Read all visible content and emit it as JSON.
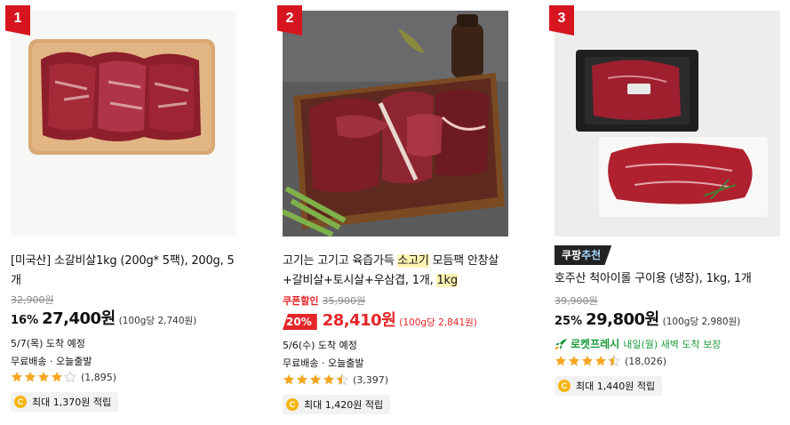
{
  "products": [
    {
      "rank": "1",
      "title_parts": [
        {
          "text": "[미국산] 소갈비살1kg (200g* 5팩), 200g, 5개",
          "hl": false
        }
      ],
      "original_price": "32,900원",
      "discount": "16%",
      "price": "27,400원",
      "unit_price": "(100g당 2,740원)",
      "delivery": "5/7(목) 도착 예정",
      "shipping": "무료배송 · 오늘출발",
      "rating": 4,
      "review_count": "(1,895)",
      "reward": "최대 1,370원 적립",
      "coin_icon": "coin-icon",
      "image_icon": "meat-photo"
    },
    {
      "rank": "2",
      "title_parts": [
        {
          "text": "고기는 고기고 육즙가득 ",
          "hl": false
        },
        {
          "text": "소고기",
          "hl": true
        },
        {
          "text": " 모듬팩 안창살+갈비살+토시살+우삼겹, 1개, ",
          "hl": false
        },
        {
          "text": "1kg",
          "hl": true
        }
      ],
      "coupon_label": "쿠폰할인",
      "original_price": "35,900원",
      "discount": "20%",
      "price": "28,410원",
      "unit_price": "(100g당 2,841원)",
      "delivery": "5/6(수) 도착 예정",
      "shipping": "무료배송 · 오늘출발",
      "rating": 4.5,
      "review_count": "(3,397)",
      "reward": "최대 1,420원 적립",
      "image_icon": "meat-photo"
    },
    {
      "rank": "3",
      "badge": {
        "left": "쿠팡",
        "right": "추천"
      },
      "title_parts": [
        {
          "text": "호주산 척아이롤 구이용 (냉장), 1kg, 1개",
          "hl": false
        }
      ],
      "original_price": "39,900원",
      "discount": "25%",
      "price": "29,800원",
      "unit_price": "(100g당 2,980원)",
      "rocket_name": "로켓프레시",
      "rocket_text": "내일(월) 새벽 도착 보장",
      "rating": 4.5,
      "review_count": "(18,026)",
      "reward": "최대 1,440원 적립",
      "image_icon": "meat-photo"
    }
  ],
  "colors": {
    "rank_badge": "#d7151f",
    "coupon_red": "#e52528",
    "rocket_green": "#1b9a3b",
    "star": "#f5a623",
    "coin": "#f5b50d"
  }
}
